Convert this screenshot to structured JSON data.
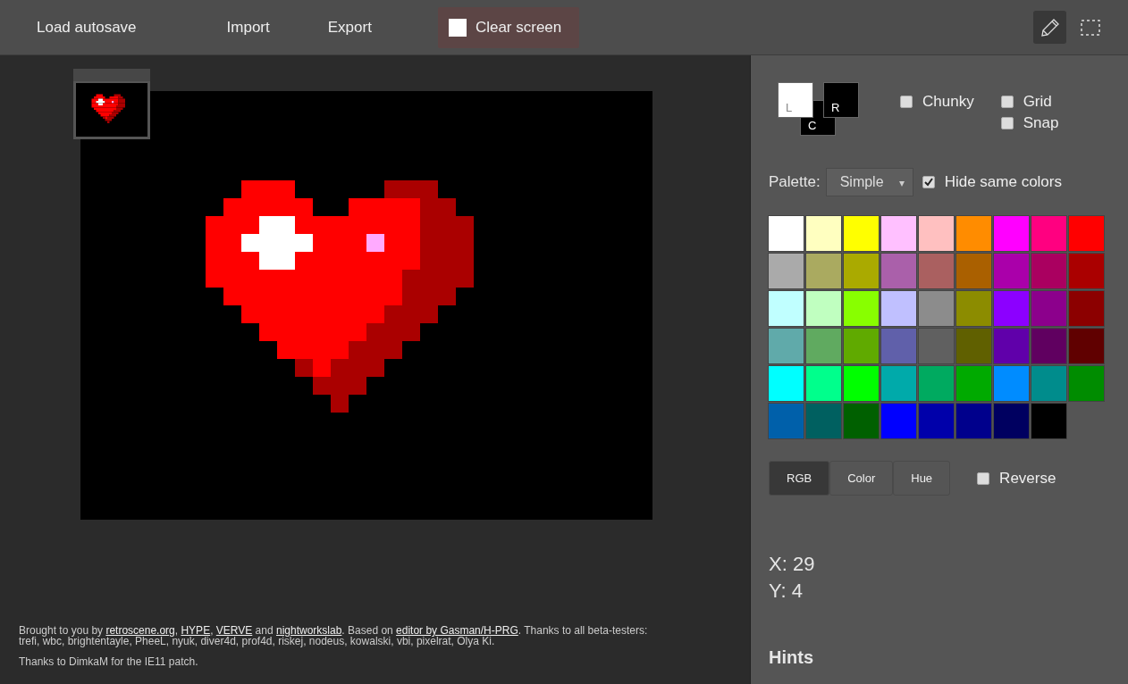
{
  "toolbar": {
    "buttons": [
      {
        "label": "Load autosave",
        "kind": "text"
      },
      {
        "label": "Import",
        "kind": "text"
      },
      {
        "label": "Export",
        "kind": "text"
      },
      {
        "label": "Clear screen",
        "kind": "swatch"
      }
    ],
    "tools": [
      {
        "kind": "pencil",
        "selected": true
      },
      {
        "kind": "marquee",
        "selected": false
      }
    ]
  },
  "colors": {
    "left": {
      "label": "L",
      "color": "#ffffff"
    },
    "center": {
      "label": "C",
      "color": "#000000"
    },
    "right": {
      "label": "R",
      "color": "#000000"
    }
  },
  "options": [
    {
      "label": "Chunky",
      "checked": false
    },
    {
      "label": "Grid",
      "checked": false
    },
    {
      "label": "Snap",
      "checked": false
    }
  ],
  "palette": {
    "label": "Palette:",
    "value": "Simple",
    "hide_same": {
      "label": "Hide same colors",
      "checked": true
    }
  },
  "swatches": [
    {
      "color": "#ffffff"
    },
    {
      "color": "#ffffc0"
    },
    {
      "color": "#ffff00"
    },
    {
      "color": "#ffc0ff"
    },
    {
      "color": "#ffc0c0"
    },
    {
      "color": "#ff8c00"
    },
    {
      "color": "#ff00ff"
    },
    {
      "color": "#ff0080"
    },
    {
      "color": "#ff0000"
    },
    {
      "color": "#aaaaaa"
    },
    {
      "color": "#aaaa60"
    },
    {
      "color": "#aaaa00"
    },
    {
      "color": "#aa60aa"
    },
    {
      "color": "#aa6060"
    },
    {
      "color": "#aa6000"
    },
    {
      "color": "#aa00aa"
    },
    {
      "color": "#aa0060"
    },
    {
      "color": "#aa0000"
    },
    {
      "color": "#c0ffff"
    },
    {
      "color": "#c0ffc0"
    },
    {
      "color": "#88ff00"
    },
    {
      "color": "#c0c0ff"
    },
    {
      "color": "#8c8c8c"
    },
    {
      "color": "#8c8c00"
    },
    {
      "color": "#8c00ff"
    },
    {
      "color": "#8c008c"
    },
    {
      "color": "#8c0000"
    },
    {
      "color": "#60aaaa"
    },
    {
      "color": "#60aa60"
    },
    {
      "color": "#60aa00"
    },
    {
      "color": "#6060aa"
    },
    {
      "color": "#606060"
    },
    {
      "color": "#606000"
    },
    {
      "color": "#6000aa"
    },
    {
      "color": "#600060"
    },
    {
      "color": "#600000"
    },
    {
      "color": "#00ffff"
    },
    {
      "color": "#00ff8c"
    },
    {
      "color": "#00ff00"
    },
    {
      "color": "#00aaaa"
    },
    {
      "color": "#00aa60"
    },
    {
      "color": "#00aa00"
    },
    {
      "color": "#008cff"
    },
    {
      "color": "#008c8c"
    },
    {
      "color": "#008c00"
    },
    {
      "color": "#0060aa"
    },
    {
      "color": "#006060"
    },
    {
      "color": "#006000"
    },
    {
      "color": "#0000ff"
    },
    {
      "color": "#0000aa"
    },
    {
      "color": "#00008c"
    },
    {
      "color": "#000060"
    },
    {
      "color": "#000000"
    }
  ],
  "sort_tabs": [
    {
      "label": "RGB",
      "selected": true
    },
    {
      "label": "Color",
      "selected": false
    },
    {
      "label": "Hue",
      "selected": false
    }
  ],
  "reverse": {
    "label": "Reverse",
    "checked": false
  },
  "coords": {
    "x": "X: 29",
    "y": "Y: 4"
  },
  "hints": {
    "title": "Hints"
  },
  "credits": [
    {
      "kind": "text",
      "text": "Brought to you by "
    },
    {
      "kind": "link",
      "text": "retroscene.org"
    },
    {
      "kind": "text",
      "text": ", "
    },
    {
      "kind": "link",
      "text": "HYPE"
    },
    {
      "kind": "text",
      "text": ", "
    },
    {
      "kind": "link",
      "text": "VERVE"
    },
    {
      "kind": "text",
      "text": " and "
    },
    {
      "kind": "link",
      "text": "nightworkslab"
    },
    {
      "kind": "text",
      "text": ". Based on "
    },
    {
      "kind": "link",
      "text": "editor by Gasman/H-PRG"
    },
    {
      "kind": "text",
      "text": ". Thanks to all beta-testers: trefi, wbc, brightentayle, PheeL, nyuk, diver4d, prof4d, riskej, nodeus, kowalski, vbi, pixelrat, Olya Ki."
    }
  ],
  "thanks": "Thanks to DimkaM for the IE11 patch."
}
